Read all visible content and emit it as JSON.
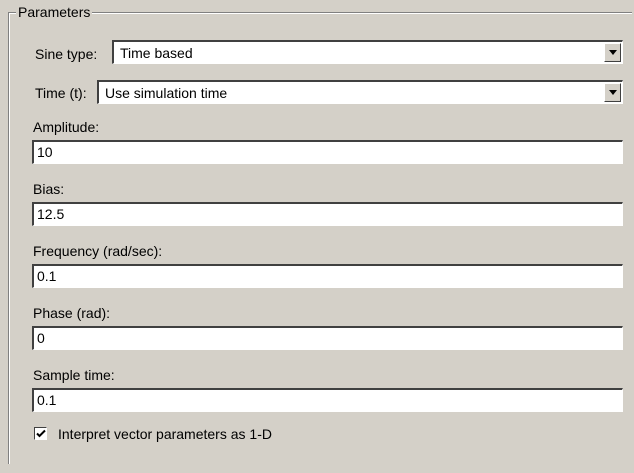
{
  "group": {
    "title": "Parameters"
  },
  "sine_type": {
    "label": "Sine type:",
    "value": "Time based"
  },
  "time": {
    "label": "Time (t):",
    "value": "Use simulation time"
  },
  "fields": [
    {
      "label": "Amplitude:",
      "value": "10"
    },
    {
      "label": "Bias:",
      "value": "12.5"
    },
    {
      "label": "Frequency (rad/sec):",
      "value": "0.1"
    },
    {
      "label": "Phase (rad):",
      "value": "0"
    },
    {
      "label": "Sample time:",
      "value": "0.1"
    }
  ],
  "interpret_vector": {
    "label": "Interpret vector parameters as 1-D",
    "checked": true
  },
  "icons": {
    "dropdown": "chevron-down-icon",
    "check": "checkmark-icon"
  }
}
